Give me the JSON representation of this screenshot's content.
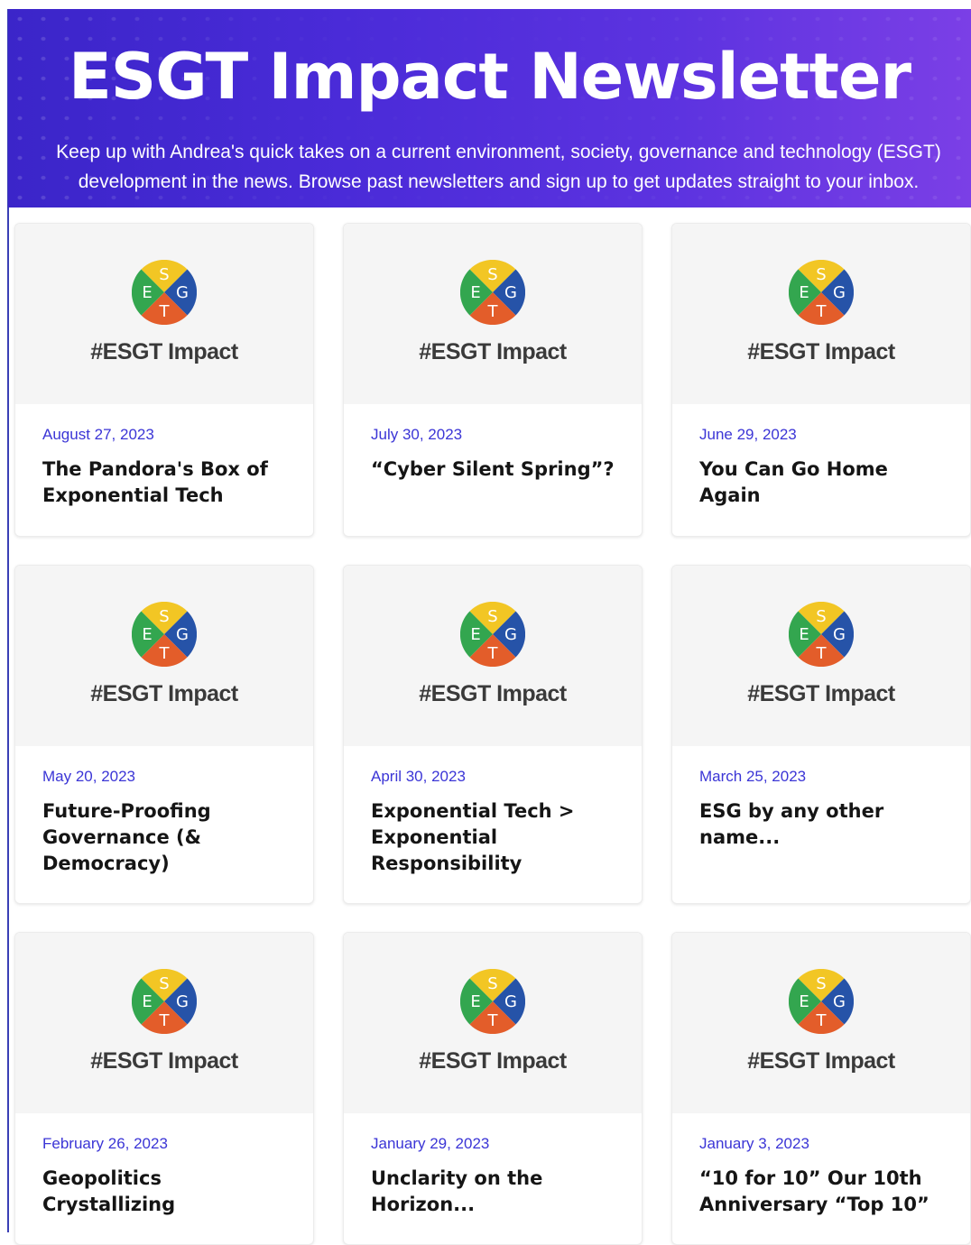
{
  "header": {
    "title": "ESGT Impact Newsletter",
    "line1": "Keep up with Andrea's quick takes on a current environment, society, governance and technology (ESGT)",
    "line2": "development in the news. Browse past newsletters and sign up to get updates straight to your inbox."
  },
  "tag": "#ESGT Impact",
  "logo_letters": {
    "top": "S",
    "left": "E",
    "right": "G",
    "bottom": "T"
  },
  "colors": {
    "header_bg": "#4a2bd8",
    "date": "#3b35d6",
    "logo_top": "#f2c624",
    "logo_left": "#33a64f",
    "logo_right": "#2653a8",
    "logo_bottom": "#e35d2a"
  },
  "posts": [
    {
      "date": "August 27, 2023",
      "title": "The Pandora's Box of Exponential Tech"
    },
    {
      "date": "July 30, 2023",
      "title": "“Cyber Silent Spring”?"
    },
    {
      "date": "June 29, 2023",
      "title": "You Can Go Home Again"
    },
    {
      "date": "May 20, 2023",
      "title": "Future-Proofing Governance (& Democracy)"
    },
    {
      "date": "April 30, 2023",
      "title": "Exponential Tech > Exponential Responsibility"
    },
    {
      "date": "March 25, 2023",
      "title": "ESG by any other name..."
    },
    {
      "date": "February 26, 2023",
      "title": "Geopolitics Crystallizing"
    },
    {
      "date": "January 29, 2023",
      "title": "Unclarity on the Horizon..."
    },
    {
      "date": "January 3, 2023",
      "title": "“10 for 10” Our 10th Anniversary “Top 10”"
    }
  ]
}
